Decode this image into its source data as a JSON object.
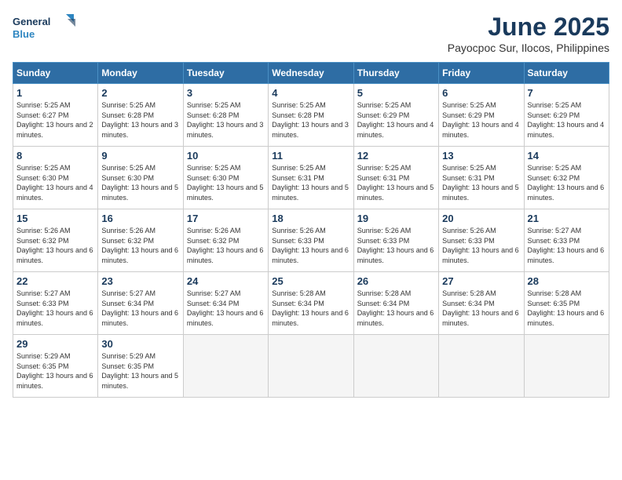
{
  "logo": {
    "line1": "General",
    "line2": "Blue"
  },
  "title": "June 2025",
  "location": "Payocpoc Sur, Ilocos, Philippines",
  "weekdays": [
    "Sunday",
    "Monday",
    "Tuesday",
    "Wednesday",
    "Thursday",
    "Friday",
    "Saturday"
  ],
  "weeks": [
    [
      {
        "day": "1",
        "sunrise": "5:25 AM",
        "sunset": "6:27 PM",
        "daylight": "13 hours and 2 minutes."
      },
      {
        "day": "2",
        "sunrise": "5:25 AM",
        "sunset": "6:28 PM",
        "daylight": "13 hours and 3 minutes."
      },
      {
        "day": "3",
        "sunrise": "5:25 AM",
        "sunset": "6:28 PM",
        "daylight": "13 hours and 3 minutes."
      },
      {
        "day": "4",
        "sunrise": "5:25 AM",
        "sunset": "6:28 PM",
        "daylight": "13 hours and 3 minutes."
      },
      {
        "day": "5",
        "sunrise": "5:25 AM",
        "sunset": "6:29 PM",
        "daylight": "13 hours and 4 minutes."
      },
      {
        "day": "6",
        "sunrise": "5:25 AM",
        "sunset": "6:29 PM",
        "daylight": "13 hours and 4 minutes."
      },
      {
        "day": "7",
        "sunrise": "5:25 AM",
        "sunset": "6:29 PM",
        "daylight": "13 hours and 4 minutes."
      }
    ],
    [
      {
        "day": "8",
        "sunrise": "5:25 AM",
        "sunset": "6:30 PM",
        "daylight": "13 hours and 4 minutes."
      },
      {
        "day": "9",
        "sunrise": "5:25 AM",
        "sunset": "6:30 PM",
        "daylight": "13 hours and 5 minutes."
      },
      {
        "day": "10",
        "sunrise": "5:25 AM",
        "sunset": "6:30 PM",
        "daylight": "13 hours and 5 minutes."
      },
      {
        "day": "11",
        "sunrise": "5:25 AM",
        "sunset": "6:31 PM",
        "daylight": "13 hours and 5 minutes."
      },
      {
        "day": "12",
        "sunrise": "5:25 AM",
        "sunset": "6:31 PM",
        "daylight": "13 hours and 5 minutes."
      },
      {
        "day": "13",
        "sunrise": "5:25 AM",
        "sunset": "6:31 PM",
        "daylight": "13 hours and 5 minutes."
      },
      {
        "day": "14",
        "sunrise": "5:25 AM",
        "sunset": "6:32 PM",
        "daylight": "13 hours and 6 minutes."
      }
    ],
    [
      {
        "day": "15",
        "sunrise": "5:26 AM",
        "sunset": "6:32 PM",
        "daylight": "13 hours and 6 minutes."
      },
      {
        "day": "16",
        "sunrise": "5:26 AM",
        "sunset": "6:32 PM",
        "daylight": "13 hours and 6 minutes."
      },
      {
        "day": "17",
        "sunrise": "5:26 AM",
        "sunset": "6:32 PM",
        "daylight": "13 hours and 6 minutes."
      },
      {
        "day": "18",
        "sunrise": "5:26 AM",
        "sunset": "6:33 PM",
        "daylight": "13 hours and 6 minutes."
      },
      {
        "day": "19",
        "sunrise": "5:26 AM",
        "sunset": "6:33 PM",
        "daylight": "13 hours and 6 minutes."
      },
      {
        "day": "20",
        "sunrise": "5:26 AM",
        "sunset": "6:33 PM",
        "daylight": "13 hours and 6 minutes."
      },
      {
        "day": "21",
        "sunrise": "5:27 AM",
        "sunset": "6:33 PM",
        "daylight": "13 hours and 6 minutes."
      }
    ],
    [
      {
        "day": "22",
        "sunrise": "5:27 AM",
        "sunset": "6:33 PM",
        "daylight": "13 hours and 6 minutes."
      },
      {
        "day": "23",
        "sunrise": "5:27 AM",
        "sunset": "6:34 PM",
        "daylight": "13 hours and 6 minutes."
      },
      {
        "day": "24",
        "sunrise": "5:27 AM",
        "sunset": "6:34 PM",
        "daylight": "13 hours and 6 minutes."
      },
      {
        "day": "25",
        "sunrise": "5:28 AM",
        "sunset": "6:34 PM",
        "daylight": "13 hours and 6 minutes."
      },
      {
        "day": "26",
        "sunrise": "5:28 AM",
        "sunset": "6:34 PM",
        "daylight": "13 hours and 6 minutes."
      },
      {
        "day": "27",
        "sunrise": "5:28 AM",
        "sunset": "6:34 PM",
        "daylight": "13 hours and 6 minutes."
      },
      {
        "day": "28",
        "sunrise": "5:28 AM",
        "sunset": "6:35 PM",
        "daylight": "13 hours and 6 minutes."
      }
    ],
    [
      {
        "day": "29",
        "sunrise": "5:29 AM",
        "sunset": "6:35 PM",
        "daylight": "13 hours and 6 minutes."
      },
      {
        "day": "30",
        "sunrise": "5:29 AM",
        "sunset": "6:35 PM",
        "daylight": "13 hours and 5 minutes."
      },
      null,
      null,
      null,
      null,
      null
    ]
  ]
}
